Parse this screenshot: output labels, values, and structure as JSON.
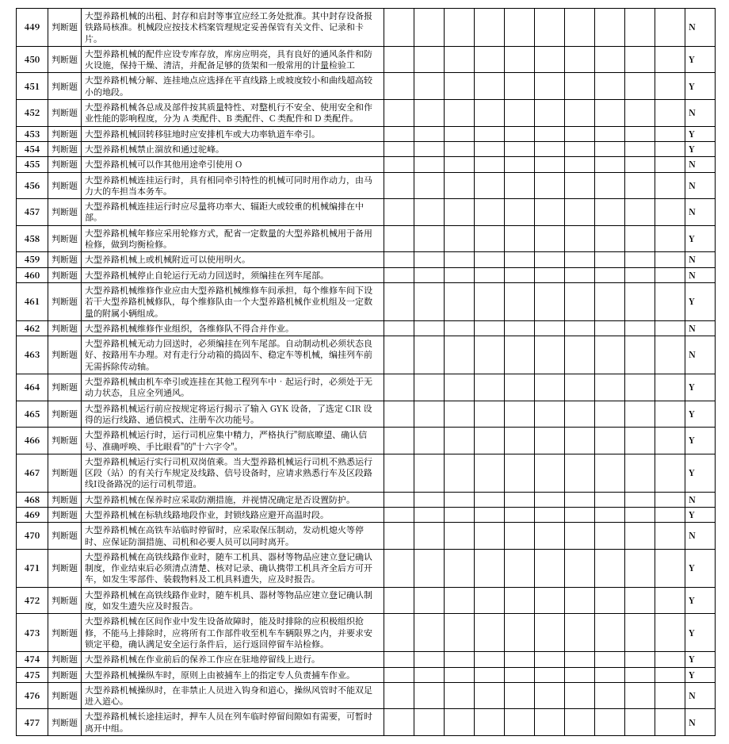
{
  "type_label": "判断题",
  "rows": [
    {
      "n": "449",
      "text": "大型养路机械的出租、封存和启封等事宜应经工务处批准。其中封存设备报铁路局核准。机械段应按技术档案管理规定妥善保管有关文件、记录和卡片。",
      "ans": "N"
    },
    {
      "n": "450",
      "text": "大型养路机械的配件应设专库存放，库房应明亮，具有良好的通风条件和防火设施，保持干燥、清洁，并配备足够的货架和一般常用的计量检验工",
      "ans": "Y"
    },
    {
      "n": "451",
      "text": "大型养路机械分解、连挂地点应选择在平直线路上或坡度较小和曲线超高较小的地段。",
      "ans": "Y"
    },
    {
      "n": "452",
      "text": "大型养路机械各总成及部件按其质量特性、对整机行不安全、使用安全和作业性能的影响程度，分为 A 类配件、B 类配件、C 类配件和 D 类配件。",
      "ans": "N"
    },
    {
      "n": "453",
      "text": "大型养路机械回转移驻地时应安排机车或大功率轨道车牵引。",
      "ans": "Y"
    },
    {
      "n": "454",
      "text": "大型养路机械禁止溜放和通过驼峰。",
      "ans": "Y"
    },
    {
      "n": "455",
      "text": "大型养路机械可以作其他用途牵引使用 O",
      "ans": "N"
    },
    {
      "n": "456",
      "text": "大型养路机械连挂运行时，具有相同牵引特性的机械可同时用作动力，由马力大的车担当本务车。",
      "ans": "N"
    },
    {
      "n": "457",
      "text": "大型养路机械连挂运行时应尽量将功率大、辐距大或较重的机械编排在中部。",
      "ans": "N"
    },
    {
      "n": "458",
      "text": "大型养路机械年修应采用轮修方式，配省一定数量的大型养路机械用于备用检修，做到均衡检修。",
      "ans": "Y"
    },
    {
      "n": "459",
      "text": "大型养路机械上或机械附近可以使用明火。",
      "ans": "N"
    },
    {
      "n": "460",
      "text": "大型养路机械停止自轮运行无动力回送时，须编挂在列车尾部。",
      "ans": "N"
    },
    {
      "n": "461",
      "text": "大型养路机械维修作业应由大型养路机械维修车间承担，每个维修车间下设若干大型养路机械修队，每个维修队由一个大型养路机械作业机组及一定数量的附属小辆组成。",
      "ans": "Y"
    },
    {
      "n": "462",
      "text": "大型养路机械维修作业组织，各维修队不得合并作业。",
      "ans": "N"
    },
    {
      "n": "463",
      "text": "大型养路机械无动力回送时，必须编挂在列车尾部。自动制动机必须状态良好、按路用车办理。对有走行分动箱的捣固车、稳定车等机械，编挂列车前无需拆除传动轴。",
      "ans": "N"
    },
    {
      "n": "464",
      "text": "大型养路机械由机车牵引或连挂在其他工程列车中•起运行时，必须处于无动力状态，且应全列通风。",
      "ans": "Y"
    },
    {
      "n": "465",
      "text": "大型养路机械运行前应按规定将运行揭示了输入 GYK 设备，了选定 CIR 设得的运行线路、通信模式、注册车次功能号。",
      "ans": "Y"
    },
    {
      "n": "466",
      "text": "大型养路机械运行时，运行司机应集中精力，严格执行\"彻底暸望、确认信号、准确呼唤、手比眼看\"的\"十六字令\"。",
      "ans": "Y"
    },
    {
      "n": "467",
      "text": "大型养路机械运行实行司机双岗值乘。当大型养路机械运行司机不熟悉运行区段（站）的有关行车规定及线路、信号设备时，应请求熟悉行车及区段路线I设备路况的运行司机带道。",
      "ans": "Y"
    },
    {
      "n": "468",
      "text": "大型养路机械在保养时应采取防潮措施，并视情况确定是否设置防护。",
      "ans": "N"
    },
    {
      "n": "469",
      "text": "大型养路机械在标轨线路地段作业，封锁线路应避开高温时段。",
      "ans": "Y"
    },
    {
      "n": "470",
      "text": "大型养路机械在高铁车站临时停留时，应采取保压制动，发动机熄火等停时、应保证防溜措施、司机和必要人员可以同时离开。",
      "ans": "N"
    },
    {
      "n": "471",
      "text": "大型养路机械在高铁线路作业时，随车工机具、器材等物品应建立登记确认制度，作业结束后必须清点清楚、核对记录、确认携带工机具齐全后方可开车，如发生零部件、装载物料及工机具料遗失，应及时报告。",
      "ans": "Y"
    },
    {
      "n": "472",
      "text": "大型养路机械在高铁线路作业时，随车机具、器材等物品应建立登记确认制度，如发生遗失应及时报告。",
      "ans": "Y"
    },
    {
      "n": "473",
      "text": "大型养路机械在区间作业中发生设备故障时，能及时排除的应积极组织抢修，不能马上排除时，应将所有工作部件收至机车车辆限界之内，并要求安锁定平稳，确认满足安全运行条件后，运行返回停留车站检修。",
      "ans": "Y"
    },
    {
      "n": "474",
      "text": "大型养路机械在作业前后的保养工作应在驻地停留线上进行。",
      "ans": "Y"
    },
    {
      "n": "475",
      "text": "大型养路机械操纵车时，原则上由被捕车上的指定专人负责捕车作业。",
      "ans": "Y"
    },
    {
      "n": "476",
      "text": "大型养路机械操纵时，在非禁止人员进入钩身和道心，操纵风管时不能双足进入道心。",
      "ans": "N"
    },
    {
      "n": "477",
      "text": "大型养路机械长途挂运时，押车人员在列车临时停留间隙如有需要，可暂时离开中组。",
      "ans": "N"
    }
  ]
}
